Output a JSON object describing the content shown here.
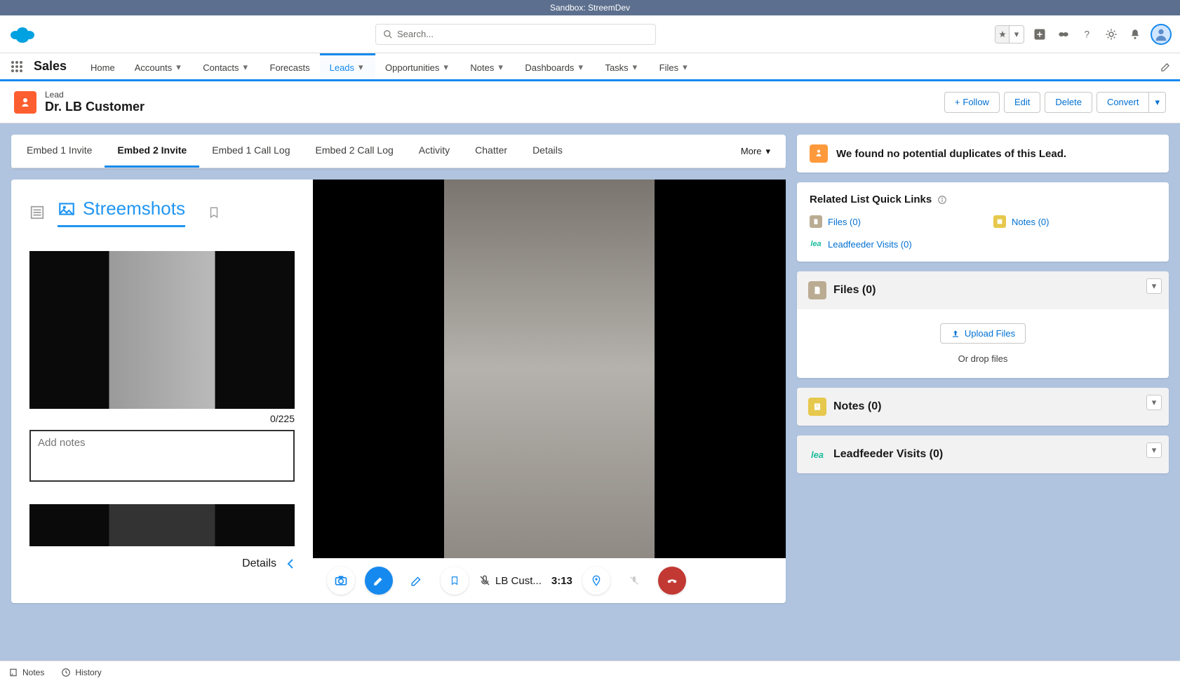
{
  "sandbox_label": "Sandbox: StreemDev",
  "search": {
    "placeholder": "Search..."
  },
  "app_name": "Sales",
  "nav": {
    "home": "Home",
    "accounts": "Accounts",
    "contacts": "Contacts",
    "forecasts": "Forecasts",
    "leads": "Leads",
    "opportunities": "Opportunities",
    "notes": "Notes",
    "dashboards": "Dashboards",
    "tasks": "Tasks",
    "files": "Files"
  },
  "record": {
    "type": "Lead",
    "name": "Dr. LB Customer",
    "actions": {
      "follow": "Follow",
      "edit": "Edit",
      "delete": "Delete",
      "convert": "Convert"
    }
  },
  "tabs": {
    "t1": "Embed 1 Invite",
    "t2": "Embed 2 Invite",
    "t3": "Embed 1 Call Log",
    "t4": "Embed 2 Call Log",
    "t5": "Activity",
    "t6": "Chatter",
    "t7": "Details",
    "more": "More"
  },
  "streem": {
    "title": "Streemshots",
    "char_count": "0/225",
    "notes_placeholder": "Add notes",
    "details": "Details",
    "call_name": "LB Cust...",
    "call_time": "3:13"
  },
  "side": {
    "duplicates": "We found no potential duplicates of this Lead.",
    "ql_title": "Related List Quick Links",
    "ql_files": "Files (0)",
    "ql_notes": "Notes (0)",
    "ql_lea": "Leadfeeder Visits (0)",
    "lea_badge": "lea",
    "files_title": "Files (0)",
    "upload": "Upload Files",
    "drop": "Or drop files",
    "notes_title": "Notes (0)",
    "lea_title": "Leadfeeder Visits (0)"
  },
  "util": {
    "notes": "Notes",
    "history": "History"
  }
}
